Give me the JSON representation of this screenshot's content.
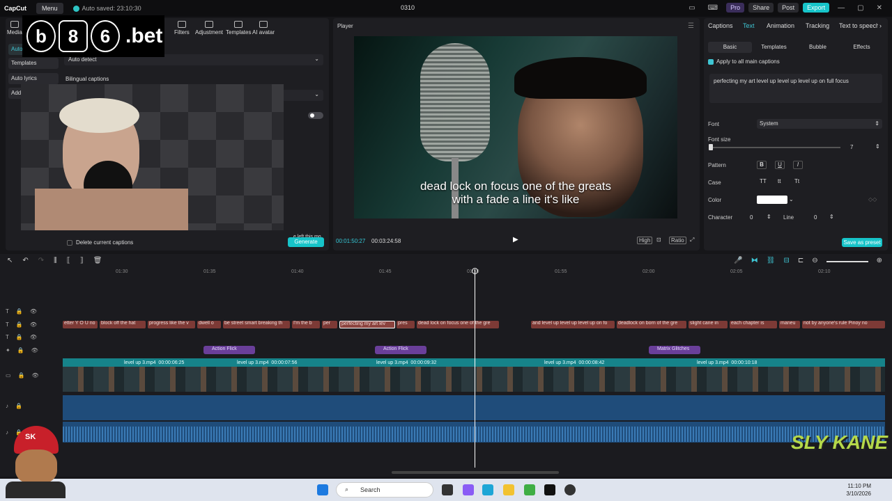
{
  "titlebar": {
    "app": "CapCut",
    "menu": "Menu",
    "autosave": "Auto saved: 23:10:30",
    "project": "0310",
    "pro": "Pro",
    "share": "Share",
    "post": "Post",
    "export": "Export"
  },
  "left": {
    "tools": [
      "Media",
      "Filters",
      "Adjustment",
      "Templates",
      "AI avatar"
    ],
    "side": [
      "Auto",
      "Templates",
      "Auto lyrics",
      "Add"
    ],
    "language_value": "Auto detect",
    "bilingual": "Bilingual captions",
    "delete_label": "Delete current captions",
    "generate": "Generate",
    "overlay_note": "e left this mo"
  },
  "player": {
    "title": "Player",
    "subtitle_line1": "dead lock on focus one of the greats",
    "subtitle_line2": "with a fade a line it's like",
    "time_current": "00:01:50:27",
    "time_total": "00:03:24:58",
    "controls": [
      "High",
      "Ratio"
    ]
  },
  "right": {
    "tabs": [
      "Captions",
      "Text",
      "Animation",
      "Tracking",
      "Text to speech"
    ],
    "subtabs": [
      "Basic",
      "Templates",
      "Bubble",
      "Effects"
    ],
    "apply_all": "Apply to all main captions",
    "text_value": "perfecting my art level up level up level up on full focus",
    "font_label": "Font",
    "font_value": "System",
    "fontsize_label": "Font size",
    "fontsize_value": "7",
    "pattern_label": "Pattern",
    "case_label": "Case",
    "case_options": [
      "TT",
      "tt",
      "Tt"
    ],
    "color_label": "Color",
    "character_label": "Character",
    "character_value": "0",
    "line_label": "Line",
    "line_value": "0",
    "save_preset": "Save as preset"
  },
  "timeline": {
    "ruler": [
      "01:30",
      "01:35",
      "01:40",
      "01:45",
      "01:50",
      "01:55",
      "02:00",
      "02:05",
      "02:10"
    ],
    "captions": [
      "etter Y O U no",
      "block off the hat",
      "progress like the v",
      "dwell o",
      "be street smart breaking th",
      "I'm the b",
      "per",
      "perfecting my art lev",
      "pres",
      "dead lock on focus one of the gre",
      "and level up level up level up on fo",
      "deadlock on born of the gre",
      "slight cane in",
      "each chapter is",
      "maneu",
      "not by anyone's rule Pinoy no"
    ],
    "effects": [
      "Action Flick",
      "Action Flick",
      "Matrix Glitches"
    ],
    "video_clips": [
      {
        "name": "level up 3.mp4",
        "dur": "00:00:06:25"
      },
      {
        "name": "level up 3.mp4",
        "dur": "00:00:07:56"
      },
      {
        "name": "level up 3.mp4",
        "dur": "00:00:09:32"
      },
      {
        "name": "level up 3.mp4",
        "dur": "00:00:08:42"
      },
      {
        "name": "level up 3.mp4",
        "dur": "00:00:10:18"
      }
    ]
  },
  "taskbar": {
    "search": "Search",
    "time": "11:10 PM",
    "date": "3/10/2026"
  },
  "overlay": {
    "brand_text": ".bet",
    "brand_badges": [
      "b",
      "8",
      "6"
    ],
    "streamer": "SLY KANE",
    "mascot_badge": "SK"
  }
}
